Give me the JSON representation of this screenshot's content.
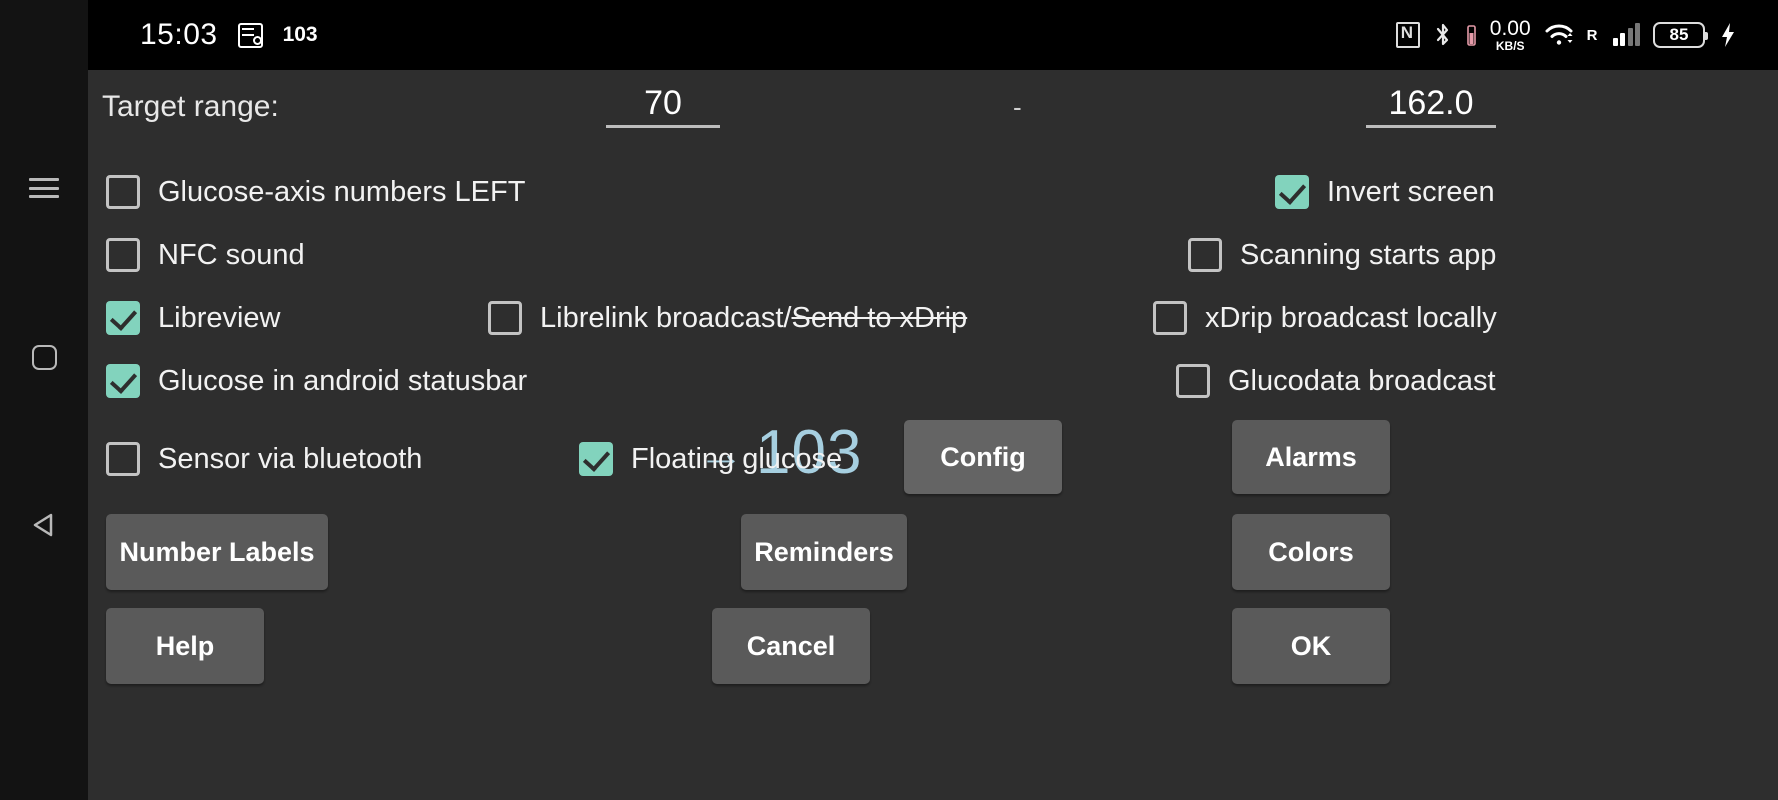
{
  "statusbar": {
    "clock": "15:03",
    "note_icon": "note-icon",
    "glucose_badge": "103",
    "nfc_icon": "nfc-icon",
    "bluetooth_icon": "bluetooth-icon",
    "network_speed_value": "0.00",
    "network_speed_unit": "KB/S",
    "wifi_icon": "wifi-icon",
    "roaming_label": "R",
    "signal_icon": "signal-bars-icon",
    "battery_percent": "85",
    "charging_icon": "lightning-bolt-icon"
  },
  "navrail": {
    "recents_label": "recents-button",
    "home_label": "home-button",
    "back_label": "back-button"
  },
  "target_range": {
    "label": "Target range:",
    "low": "70",
    "separator": "-",
    "high": "162.0"
  },
  "checkboxes": [
    {
      "label": "Glucose-axis numbers LEFT",
      "checked": false
    },
    {
      "label": "Invert screen",
      "checked": true
    },
    {
      "label": "NFC sound",
      "checked": false
    },
    {
      "label": "Scanning starts app",
      "checked": false
    },
    {
      "label": "Libreview",
      "checked": true
    },
    {
      "label": "Librelink broadcast/",
      "label_struck": "Send to xDrip",
      "checked": false
    },
    {
      "label": "xDrip broadcast locally",
      "checked": false
    },
    {
      "label": "Glucose in android statusbar",
      "checked": true
    },
    {
      "label": "Glucodata broadcast",
      "checked": false
    },
    {
      "label": "Sensor via bluetooth",
      "checked": false
    },
    {
      "label": "Floating glucose",
      "checked": true
    }
  ],
  "glucose_readout": {
    "arrow": "→",
    "value": "103",
    "color": "#a6cfe0"
  },
  "buttons": {
    "config": "Config",
    "alarms": "Alarms",
    "number_labels": "Number Labels",
    "reminders": "Reminders",
    "colors": "Colors",
    "help": "Help",
    "cancel": "Cancel",
    "ok": "OK"
  },
  "colors": {
    "background": "#2e2e2e",
    "statusbar_bg": "#000000",
    "navrail_bg": "#131313",
    "checkbox_on": "#82d3bd",
    "button_bg": "#5a5a5a",
    "accent_readout": "#a6cfe0"
  }
}
